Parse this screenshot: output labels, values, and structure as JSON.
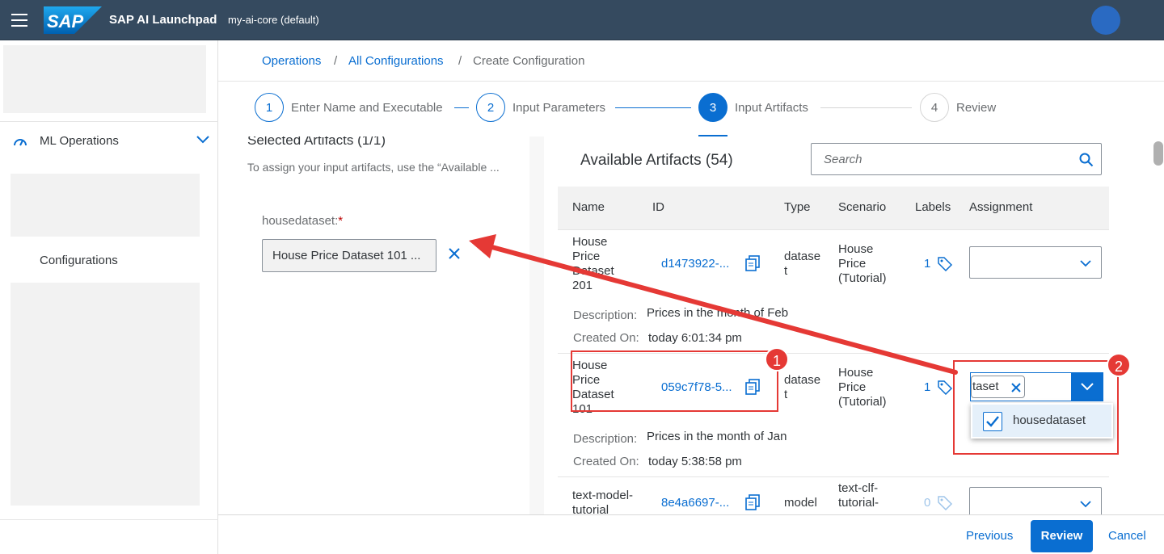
{
  "shell": {
    "logo_text": "SAP",
    "title": "SAP AI Launchpad",
    "subtitle": "my-ai-core (default)"
  },
  "sidenav": {
    "ml_operations": "ML Operations",
    "configurations": "Configurations"
  },
  "breadcrumb": {
    "items": [
      "Operations",
      "All Configurations",
      "Create Configuration"
    ],
    "separator": "/"
  },
  "wizard": {
    "steps": [
      {
        "number": "1",
        "label": "Enter Name and Executable",
        "state": "done"
      },
      {
        "number": "2",
        "label": "Input Parameters",
        "state": "done"
      },
      {
        "number": "3",
        "label": "Input Artifacts",
        "state": "active"
      },
      {
        "number": "4",
        "label": "Review",
        "state": "pending"
      }
    ]
  },
  "selected": {
    "title": "Selected Artifacts (1/1)",
    "description": "To assign your input artifacts, use the “Available ...",
    "field_label": "housedataset:",
    "required_mark": "*",
    "field_value": "House Price Dataset 101 ..."
  },
  "available": {
    "title": "Available Artifacts (54)",
    "search_placeholder": "Search",
    "columns": [
      "Name",
      "ID",
      "Type",
      "Scenario",
      "Labels",
      "Assignment"
    ],
    "description_label": "Description:",
    "created_label": "Created On:",
    "rows": [
      {
        "name": [
          "House",
          "Price",
          "Dataset",
          "201"
        ],
        "id": "d1473922-...",
        "type": [
          "datase",
          "t"
        ],
        "scenario": [
          "House",
          "Price",
          "(Tutorial)"
        ],
        "labels": "1",
        "description": "Prices in the month of Feb",
        "created": "today 6:01:34 pm"
      },
      {
        "name": [
          "House",
          "Price",
          "Dataset",
          "101"
        ],
        "id": "059c7f78-5...",
        "type": [
          "datase",
          "t"
        ],
        "scenario": [
          "House",
          "Price",
          "(Tutorial)"
        ],
        "labels": "1",
        "assignment_token": "taset",
        "description": "Prices in the month of Jan",
        "created": "today 5:38:58 pm"
      },
      {
        "name": [
          "text-model-",
          "tutorial"
        ],
        "id": "8e4a6697-...",
        "type": [
          "model"
        ],
        "scenario": [
          "text-clf-",
          "tutorial-"
        ],
        "labels": "0"
      }
    ],
    "dropdown_option": "housedataset"
  },
  "footer": {
    "previous": "Previous",
    "review": "Review",
    "cancel": "Cancel"
  },
  "annotations": {
    "marker1": "1",
    "marker2": "2",
    "color": "#e53935"
  },
  "colors": {
    "shell": "#354a5f",
    "accent": "#0a6ed1",
    "text": "#32363a"
  }
}
